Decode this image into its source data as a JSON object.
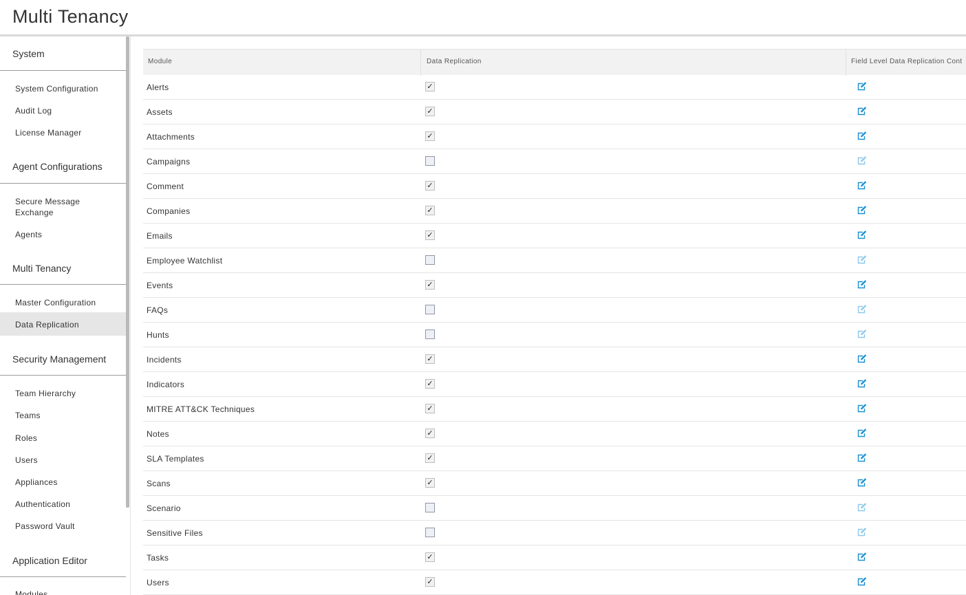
{
  "page": {
    "title": "Multi Tenancy"
  },
  "colors": {
    "edit_icon_enabled": "#1a8fd1",
    "edit_icon_disabled": "#8ec8ea",
    "active_nav_bg": "#e6e6e6"
  },
  "sidebar": {
    "sections": [
      {
        "label": "System",
        "items": [
          "System Configuration",
          "Audit Log",
          "License Manager"
        ]
      },
      {
        "label": "Agent Configurations",
        "items": [
          "Secure Message Exchange",
          "Agents"
        ]
      },
      {
        "label": "Multi Tenancy",
        "items": [
          "Master Configuration",
          "Data Replication"
        ]
      },
      {
        "label": "Security Management",
        "items": [
          "Team Hierarchy",
          "Teams",
          "Roles",
          "Users",
          "Appliances",
          "Authentication",
          "Password Vault"
        ]
      },
      {
        "label": "Application Editor",
        "items": [
          "Modules"
        ]
      }
    ],
    "active_item": "Data Replication"
  },
  "table": {
    "columns": [
      "Module",
      "Data Replication",
      "Field Level Data Replication Cont"
    ],
    "rows": [
      {
        "module": "Alerts",
        "replicated": true,
        "edit_icon": "edit-icon"
      },
      {
        "module": "Assets",
        "replicated": true,
        "edit_icon": "edit-icon"
      },
      {
        "module": "Attachments",
        "replicated": true,
        "edit_icon": "edit-icon"
      },
      {
        "module": "Campaigns",
        "replicated": false,
        "edit_icon": "edit-icon"
      },
      {
        "module": "Comment",
        "replicated": true,
        "edit_icon": "edit-icon"
      },
      {
        "module": "Companies",
        "replicated": true,
        "edit_icon": "edit-icon"
      },
      {
        "module": "Emails",
        "replicated": true,
        "edit_icon": "edit-icon"
      },
      {
        "module": "Employee Watchlist",
        "replicated": false,
        "edit_icon": "edit-icon"
      },
      {
        "module": "Events",
        "replicated": true,
        "edit_icon": "edit-icon"
      },
      {
        "module": "FAQs",
        "replicated": false,
        "edit_icon": "edit-icon"
      },
      {
        "module": "Hunts",
        "replicated": false,
        "edit_icon": "edit-icon"
      },
      {
        "module": "Incidents",
        "replicated": true,
        "edit_icon": "edit-icon"
      },
      {
        "module": "Indicators",
        "replicated": true,
        "edit_icon": "edit-icon"
      },
      {
        "module": "MITRE ATT&CK Techniques",
        "replicated": true,
        "edit_icon": "edit-icon"
      },
      {
        "module": "Notes",
        "replicated": true,
        "edit_icon": "edit-icon"
      },
      {
        "module": "SLA Templates",
        "replicated": true,
        "edit_icon": "edit-icon"
      },
      {
        "module": "Scans",
        "replicated": true,
        "edit_icon": "edit-icon"
      },
      {
        "module": "Scenario",
        "replicated": false,
        "edit_icon": "edit-icon"
      },
      {
        "module": "Sensitive Files",
        "replicated": false,
        "edit_icon": "edit-icon"
      },
      {
        "module": "Tasks",
        "replicated": true,
        "edit_icon": "edit-icon"
      },
      {
        "module": "Users",
        "replicated": true,
        "edit_icon": "edit-icon"
      }
    ]
  }
}
